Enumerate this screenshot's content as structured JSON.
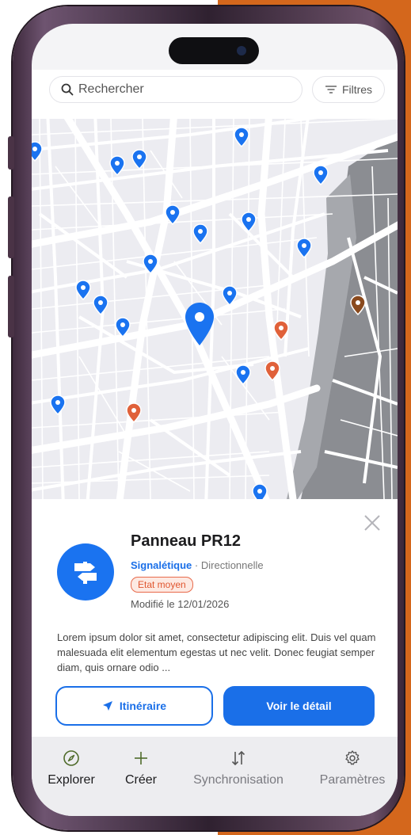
{
  "colors": {
    "brand_blue": "#1a6fe8",
    "pin_blue": "#1a73f0",
    "pin_orange": "#e0613a",
    "pin_brown": "#8a4a1e",
    "warning_badge": "#e0552f",
    "background_orange": "#d4671c"
  },
  "search": {
    "placeholder": "Rechercher",
    "value": ""
  },
  "filters": {
    "label": "Filtres",
    "icon": "filter-lines-icon"
  },
  "map": {
    "selected_pin": "location-pin-icon"
  },
  "detail_card": {
    "title": "Panneau PR12",
    "category": "Signalétique",
    "separator": " · ",
    "subcategory": "Directionnelle",
    "status_badge": "Etat moyen",
    "modified": "Modifié le 12/01/2026",
    "description": "Lorem ipsum dolor sit amet, consectetur adipiscing elit. Duis vel quam malesuada elit elementum egestas ut nec velit. Donec feugiat semper diam, quis ornare odio ...",
    "route_button": "Itinéraire",
    "detail_button": "Voir le détail",
    "avatar_icon": "signpost-icon"
  },
  "tabbar": {
    "items": [
      {
        "label": "Explorer",
        "icon": "compass-icon",
        "active": true
      },
      {
        "label": "Créer",
        "icon": "plus-icon",
        "active": true
      },
      {
        "label": "Synchronisation",
        "icon": "sort-arrows-icon",
        "active": false
      },
      {
        "label": "Paramètres",
        "icon": "gear-icon",
        "active": false
      }
    ]
  }
}
